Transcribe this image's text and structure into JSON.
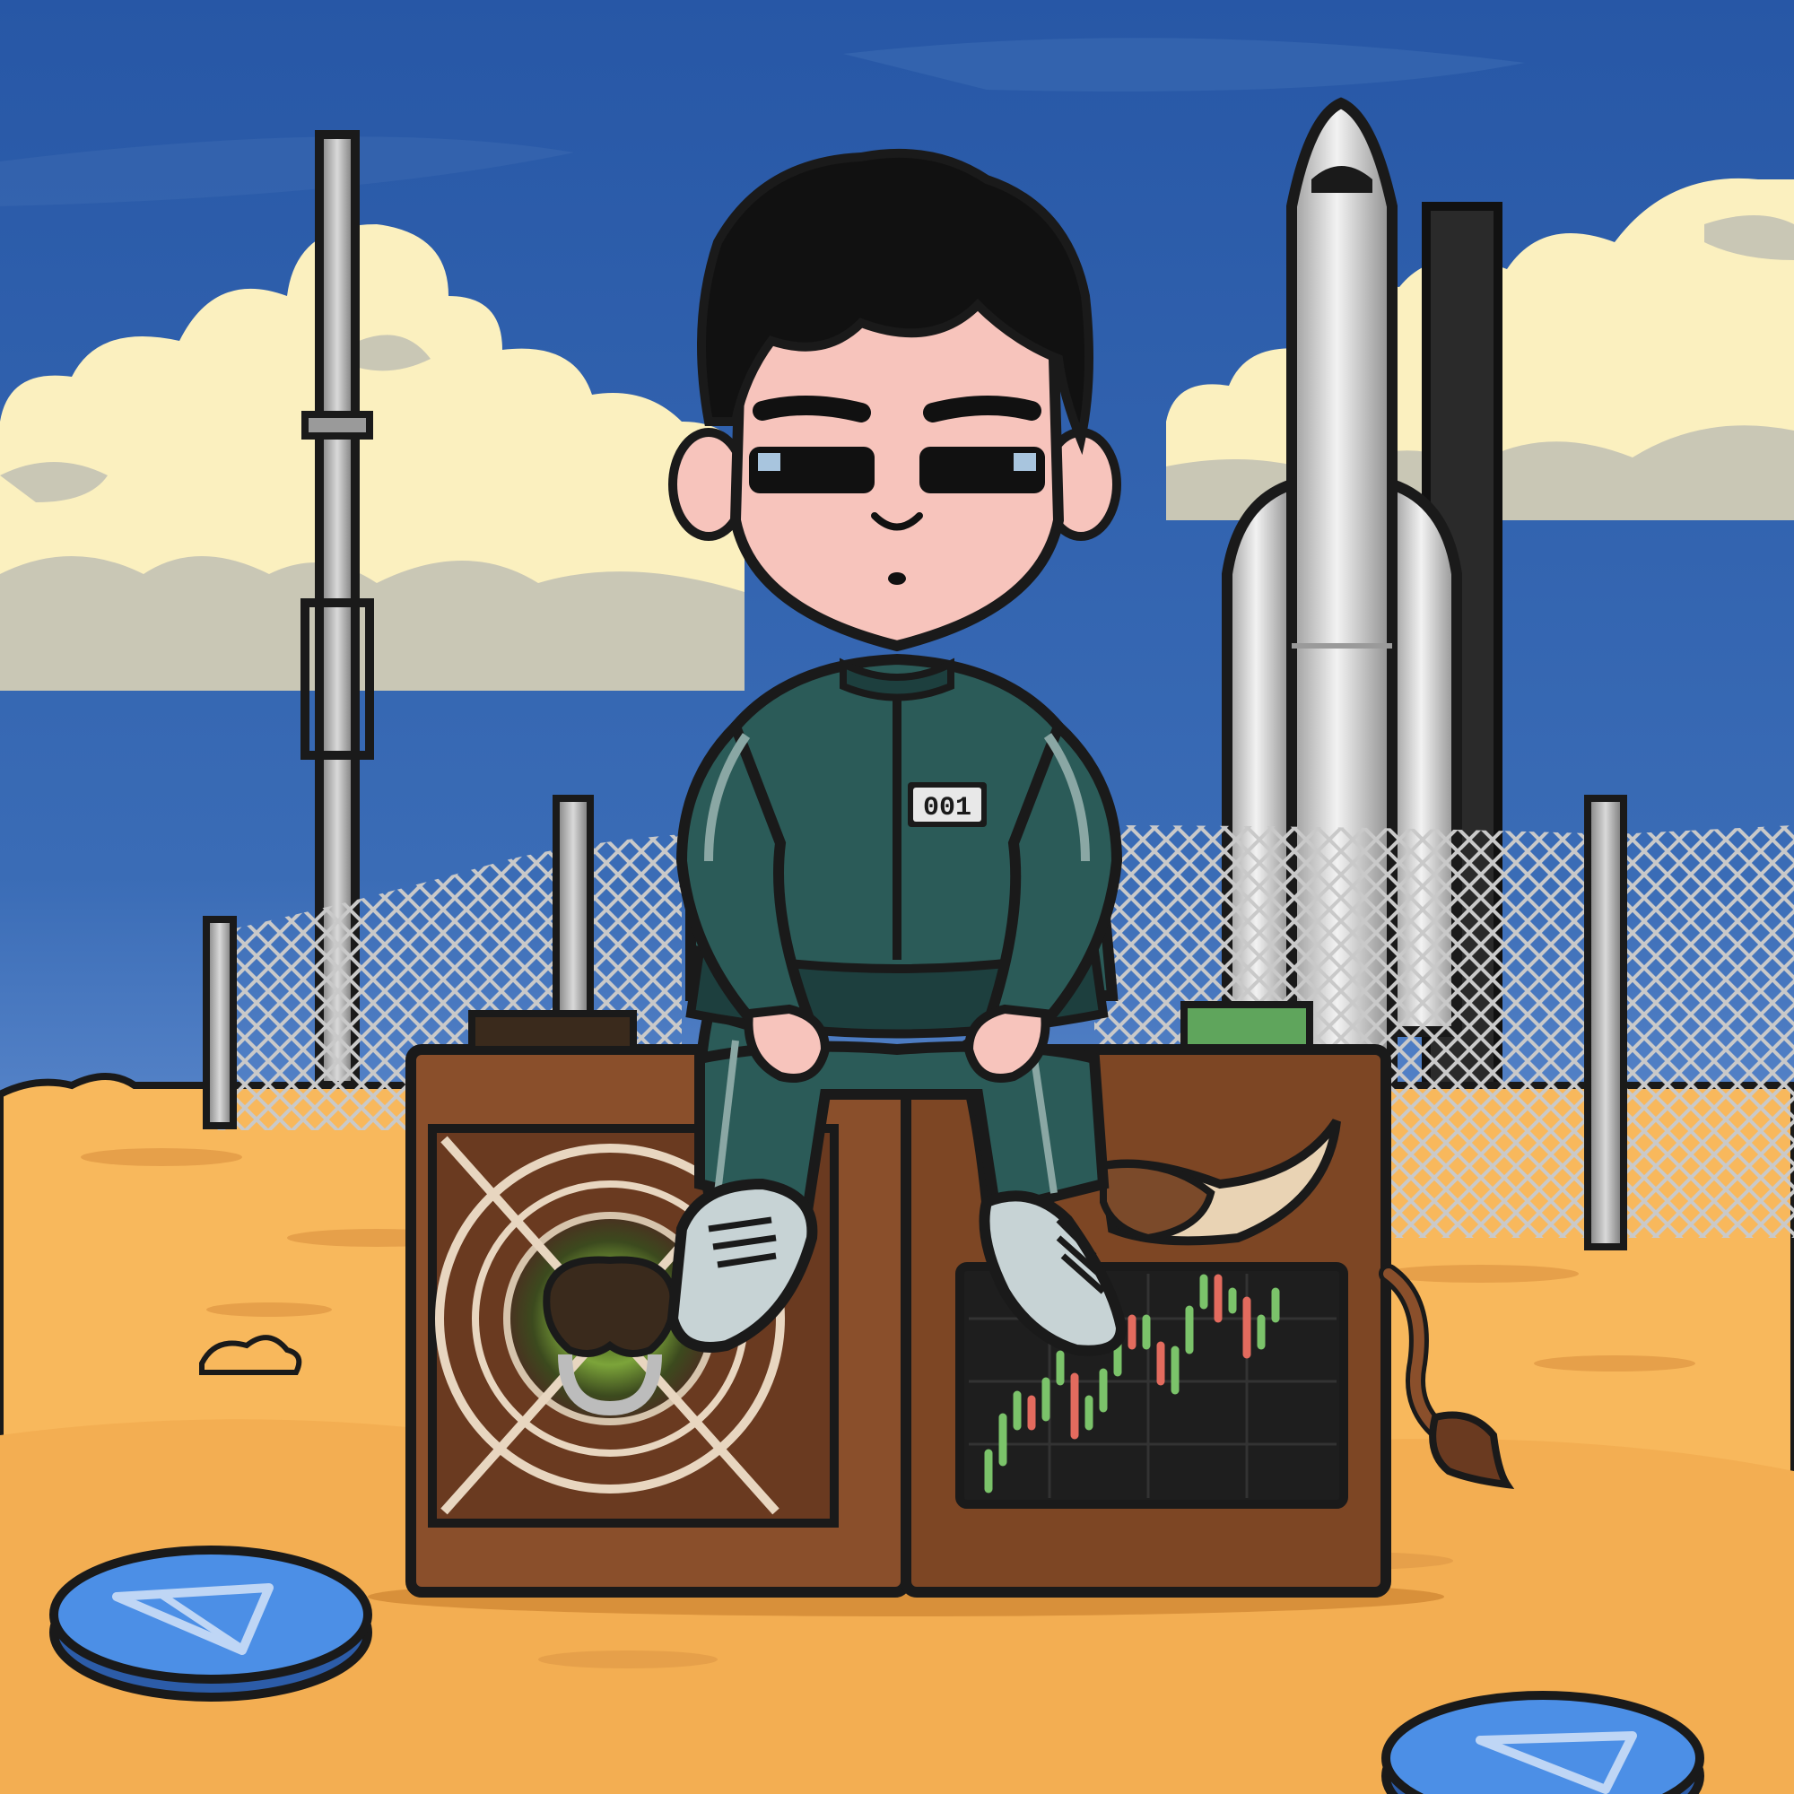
{
  "scene": {
    "chest_number": "001"
  },
  "colors": {
    "sky": "#2b5ca8",
    "sky_light": "#4d7ec4",
    "cloud": "#fbf0bf",
    "cloud_shadow": "#c9c7b5",
    "sand": "#f8b85c",
    "sand_dark": "#e09a40",
    "box": "#8a4f2b",
    "box_dark": "#5a3018",
    "tracksuit": "#2b5b58",
    "tracksuit_dark": "#1d3f3e",
    "skin": "#f7c4bc",
    "hair": "#111111",
    "coin": "#4c8fe6",
    "candle_up": "#7bc36a",
    "candle_down": "#e36b5e"
  },
  "icons": [
    "rocket",
    "tower",
    "fence",
    "mining-box",
    "fan",
    "bull-nose-ring",
    "price-chart",
    "bull-horn",
    "bull-tail",
    "ton-coin"
  ]
}
